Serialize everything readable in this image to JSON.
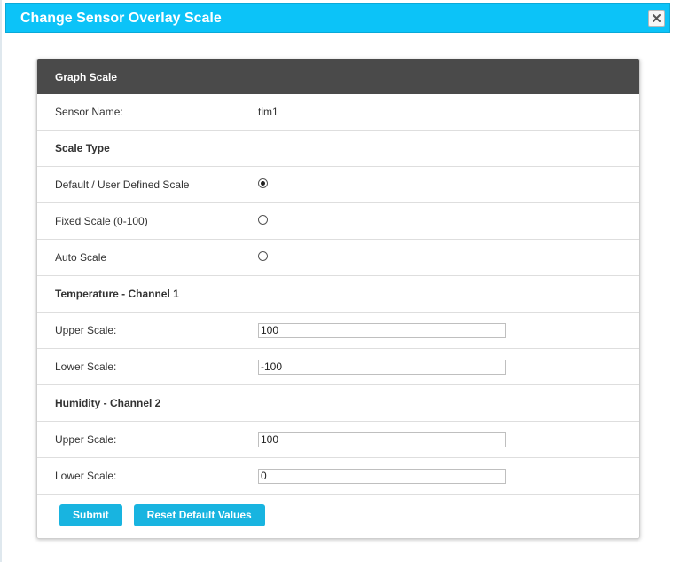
{
  "dialog": {
    "title": "Change Sensor Overlay Scale",
    "close_icon": "close-x-icon"
  },
  "panel": {
    "header": "Graph Scale",
    "sensor_name_label": "Sensor Name:",
    "sensor_name_value": "tim1",
    "scale_type_heading": "Scale Type",
    "scale_options": [
      {
        "label": "Default / User Defined Scale",
        "selected": true
      },
      {
        "label": "Fixed Scale (0-100)",
        "selected": false
      },
      {
        "label": "Auto Scale",
        "selected": false
      }
    ],
    "channel1": {
      "heading": "Temperature - Channel 1",
      "upper_label": "Upper Scale:",
      "upper_value": "100",
      "lower_label": "Lower Scale:",
      "lower_value": "-100"
    },
    "channel2": {
      "heading": "Humidity - Channel 2",
      "upper_label": "Upper Scale:",
      "upper_value": "100",
      "lower_label": "Lower Scale:",
      "lower_value": "0"
    },
    "buttons": {
      "submit": "Submit",
      "reset": "Reset Default Values"
    }
  },
  "colors": {
    "titlebar": "#0cc3f8",
    "panel_header": "#4a4a4a",
    "button": "#18b4e0"
  }
}
